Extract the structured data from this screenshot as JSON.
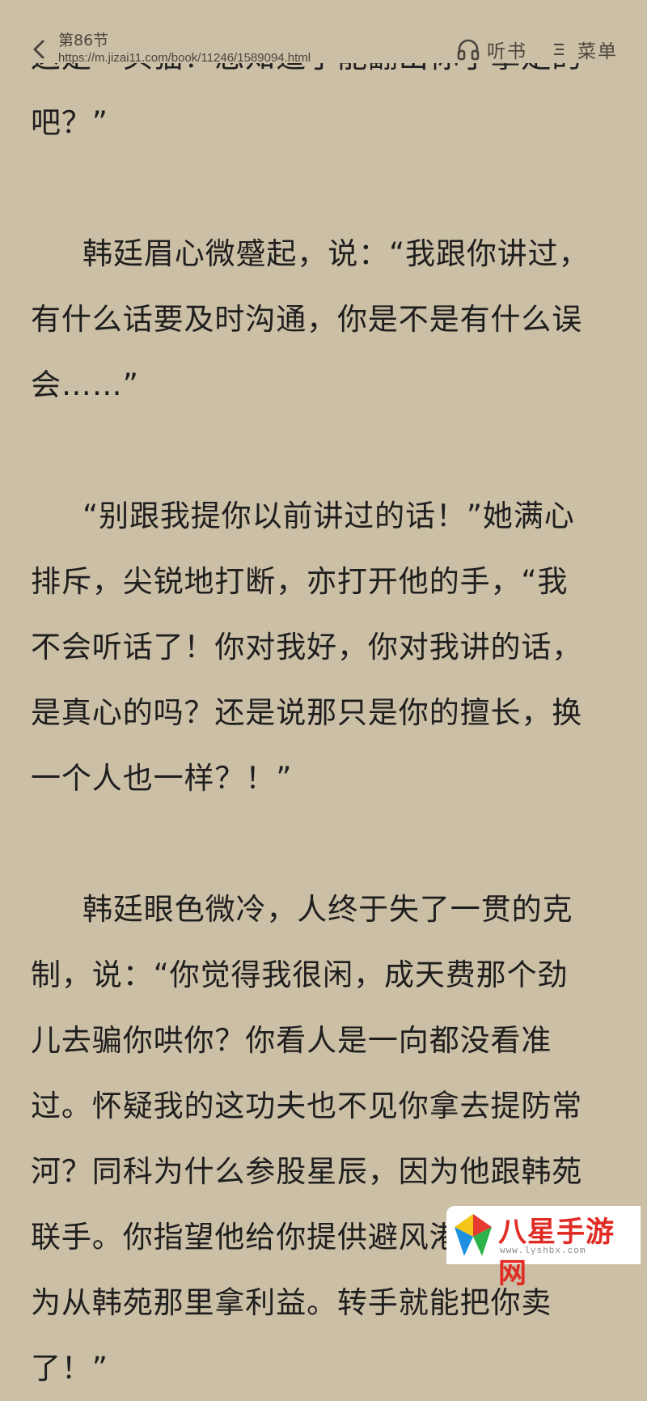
{
  "header": {
    "chapter_title": "第86节",
    "url": "https://m.jizai11.com/book/11246/1589094.html",
    "listen_label": "听书",
    "menu_label": "菜单",
    "icons": {
      "back": "chevron-left-icon",
      "listen": "headphones-icon",
      "menu": "menu-lines-icon"
    }
  },
  "content": {
    "lines": [
      "这是一头猫？您知道了能翻出你了拿走的",
      "吧？”",
      "",
      "韩廷眉心微蹙起，说：“我跟你讲过，",
      "有什么话要及时沟通，你是不是有什么误",
      "会……”",
      "",
      "“别跟我提你以前讲过的话！”她满心",
      "排斥，尖锐地打断，亦打开他的手，“我",
      "不会听话了！你对我好，你对我讲的话，",
      "是真心的吗？还是说那只是你的擅长，换",
      "一个人也一样？！”",
      "",
      "韩廷眼色微冷，人终于失了一贯的克",
      "制，说：“你觉得我很闲，成天费那个劲",
      "儿去骗你哄你？你看人是一向都没看准",
      "过。怀疑我的这功夫也不见你拿去提防常",
      "河？同科为什么参股星辰，因为他跟韩苑",
      "联手。你指望他给你提供避风港，他却只",
      "为从韩苑那里拿利益。转手就能把你卖",
      "了！”"
    ]
  },
  "watermark": {
    "text": "八星手游网",
    "url": "www.lyshbx.com",
    "colors": {
      "text": "#e02c24",
      "logo_red": "#e53a2f",
      "logo_yellow": "#f5c518",
      "logo_green": "#2bb34a",
      "logo_blue": "#1f8fe0"
    }
  },
  "theme": {
    "background": "#cbbfa6",
    "text": "#1e1e1e",
    "chrome_text": "#4b463e"
  }
}
